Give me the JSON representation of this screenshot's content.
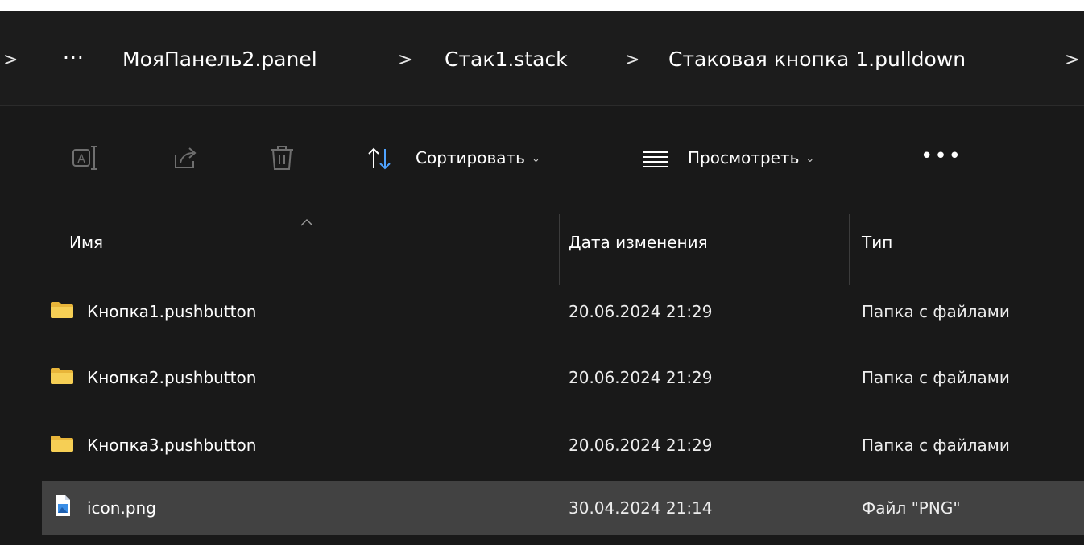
{
  "breadcrumb": {
    "leading_sep": ">",
    "overflow": "···",
    "items": [
      "МояПанель2.panel",
      "Стак1.stack",
      "Стаковая кнопка 1.pulldown"
    ],
    "sep": ">"
  },
  "toolbar": {
    "icons": [
      "rename-icon",
      "share-icon",
      "delete-icon"
    ],
    "sort_label": "Сортировать",
    "view_label": "Просмотреть",
    "more_label": "•••"
  },
  "columns": {
    "name": "Имя",
    "date": "Дата изменения",
    "type": "Тип"
  },
  "files": [
    {
      "name": "Кнопка1.pushbutton",
      "date": "20.06.2024 21:29",
      "type": "Папка с файлами",
      "icon": "folder-icon",
      "selected": false
    },
    {
      "name": "Кнопка2.pushbutton",
      "date": "20.06.2024 21:29",
      "type": "Папка с файлами",
      "icon": "folder-icon",
      "selected": false
    },
    {
      "name": "Кнопка3.pushbutton",
      "date": "20.06.2024 21:29",
      "type": "Папка с файлами",
      "icon": "folder-icon",
      "selected": false
    },
    {
      "name": "icon.png",
      "date": "30.04.2024 21:14",
      "type": "Файл \"PNG\"",
      "icon": "png-file-icon",
      "selected": true
    }
  ],
  "colors": {
    "background": "#191919",
    "selected_row": "#424242",
    "folder": "#f2c94c",
    "sort_arrow_accent": "#4fa3ff"
  }
}
